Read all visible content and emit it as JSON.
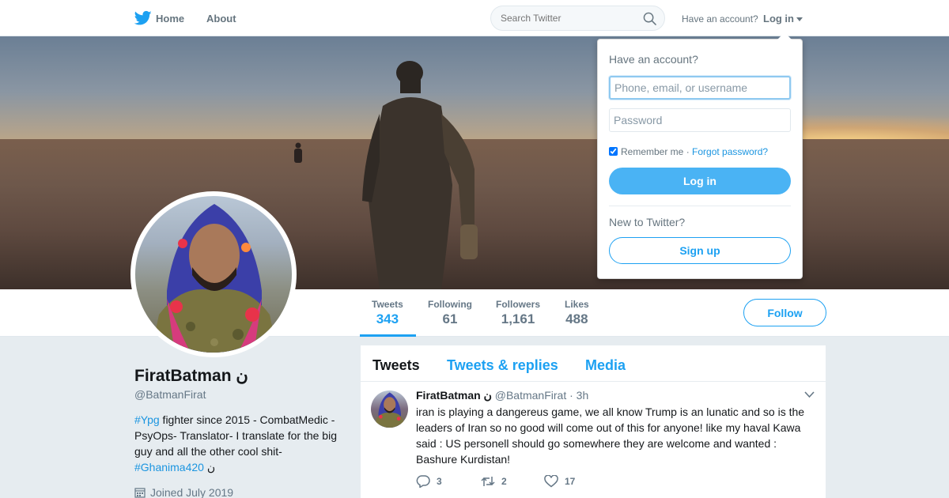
{
  "colors": {
    "brand": "#1da1f2",
    "link": "#1b95e0",
    "login_button": "#4ab3f4",
    "background": "#e6ecf0"
  },
  "nav": {
    "logo_icon": "twitter-bird-icon",
    "home_label": "Home",
    "about_label": "About",
    "search_placeholder": "Search Twitter",
    "search_icon": "search-icon",
    "have_account": "Have an account?",
    "login_label": "Log in"
  },
  "profile": {
    "name": "FiratBatman ن",
    "handle": "@BatmanFirat",
    "bio_tag1": "#Ypg",
    "bio_text": " fighter since 2015 - CombatMedic - PsyOps- Translator- I translate for the big guy and all the other cool shit-",
    "bio_tag2": "#Ghanima420",
    "bio_tail": " ن",
    "joined": "Joined July 2019",
    "stats": {
      "tweets_label": "Tweets",
      "tweets_value": "343",
      "following_label": "Following",
      "following_value": "61",
      "followers_label": "Followers",
      "followers_value": "1,161",
      "likes_label": "Likes",
      "likes_value": "488"
    },
    "follow_label": "Follow"
  },
  "timeline": {
    "tabs": [
      "Tweets",
      "Tweets & replies",
      "Media"
    ],
    "active_tab": "Tweets",
    "tweet": {
      "name": "FiratBatman ن",
      "handle": "@BatmanFirat",
      "separator": " · ",
      "time": "3h",
      "text": "iran is playing a dangereus game, we all know Trump is an lunatic and so is the leaders of Iran so no good will come out of this for anyone! like my haval Kawa said : US personell should go somewhere they are welcome and wanted : Bashure Kurdistan!",
      "replies": "3",
      "retweets": "2",
      "likes": "17"
    }
  },
  "login_dropdown": {
    "title": "Have an account?",
    "username_placeholder": "Phone, email, or username",
    "password_placeholder": "Password",
    "remember_me": "Remember me",
    "separator": " · ",
    "forgot_password": "Forgot password?",
    "remember_checked": true,
    "login_button": "Log in",
    "new_to_twitter": "New to Twitter?",
    "signup_button": "Sign up"
  }
}
